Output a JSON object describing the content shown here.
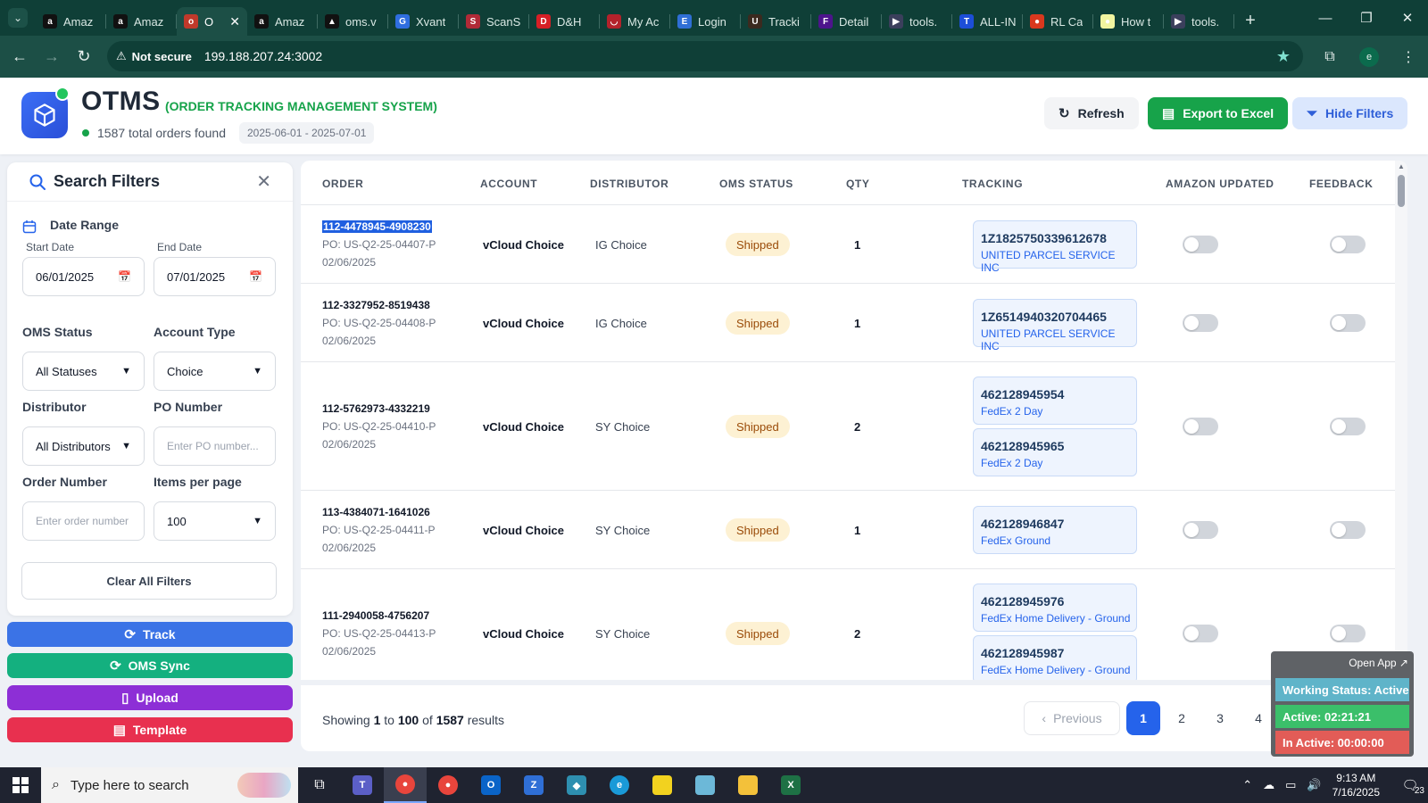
{
  "browser": {
    "tabs": [
      {
        "title": "Amaz",
        "fav_color": "#111111",
        "fav_glyph": "a"
      },
      {
        "title": "Amaz",
        "fav_color": "#111111",
        "fav_glyph": "a"
      },
      {
        "title": "O",
        "fav_color": "#c0392b",
        "fav_glyph": "o",
        "active": true
      },
      {
        "title": "Amaz",
        "fav_color": "#111111",
        "fav_glyph": "a"
      },
      {
        "title": "oms.v",
        "fav_color": "#111111",
        "fav_glyph": "▲"
      },
      {
        "title": "Xvant",
        "fav_color": "#2f6ee0",
        "fav_glyph": "G"
      },
      {
        "title": "ScanS",
        "fav_color": "#b02a37",
        "fav_glyph": "S"
      },
      {
        "title": "D&H",
        "fav_color": "#d61f26",
        "fav_glyph": "D"
      },
      {
        "title": "My Ac",
        "fav_color": "#b3222b",
        "fav_glyph": "◡"
      },
      {
        "title": "Login",
        "fav_color": "#2f6fd6",
        "fav_glyph": "E"
      },
      {
        "title": "Tracki",
        "fav_color": "#3b2a1f",
        "fav_glyph": "U"
      },
      {
        "title": "Detail",
        "fav_color": "#4d148c",
        "fav_glyph": "F"
      },
      {
        "title": "tools.",
        "fav_color": "#3b3f5c",
        "fav_glyph": "▶"
      },
      {
        "title": "ALL-IN",
        "fav_color": "#1d4ed8",
        "fav_glyph": "T"
      },
      {
        "title": "RL Ca",
        "fav_color": "#d9381e",
        "fav_glyph": "●"
      },
      {
        "title": "How t",
        "fav_color": "#f1f5a0",
        "fav_glyph": "●"
      },
      {
        "title": "tools.",
        "fav_color": "#3b3f5c",
        "fav_glyph": "▶"
      }
    ],
    "new_tab": "+",
    "security": "Not secure",
    "url": "199.188.207.24:3002",
    "profile_initial": "e"
  },
  "header": {
    "title": "OTMS",
    "subtitle": "(ORDER TRACKING MANAGEMENT SYSTEM)",
    "orders_found": "1587 total orders found",
    "date_range": "2025-06-01 - 2025-07-01",
    "refresh_label": "Refresh",
    "export_label": "Export to Excel",
    "hide_filters_label": "Hide Filters",
    "accent_color": "#17a34a",
    "brand_color": "#2f5fd8"
  },
  "filters": {
    "title": "Search Filters",
    "close": "✕",
    "date_range_label": "Date Range",
    "start_date_label": "Start Date",
    "start_date": "06/01/2025",
    "end_date_label": "End Date",
    "end_date": "07/01/2025",
    "oms_status_label": "OMS Status",
    "oms_status_value": "All Statuses",
    "account_type_label": "Account Type",
    "account_type_value": "Choice",
    "distributor_label": "Distributor",
    "distributor_value": "All Distributors",
    "po_number_label": "PO Number",
    "po_number_placeholder": "Enter PO number...",
    "order_number_label": "Order Number",
    "order_number_placeholder": "Enter order number",
    "items_per_page_label": "Items per page",
    "items_per_page_value": "100",
    "clear_label": "Clear All Filters"
  },
  "actions": {
    "track": "Track",
    "oms_sync": "OMS Sync",
    "upload": "Upload",
    "template": "Template"
  },
  "table": {
    "columns": [
      "ORDER",
      "ACCOUNT",
      "DISTRIBUTOR",
      "OMS STATUS",
      "QTY",
      "TRACKING",
      "AMAZON UPDATED",
      "FEEDBACK"
    ],
    "rows": [
      {
        "order": "112-4478945-4908230",
        "po": "PO: US-Q2-25-04407-P",
        "date": "02/06/2025",
        "account": "vCloud Choice",
        "distributor": "IG Choice",
        "status": "Shipped",
        "qty": "1",
        "tracking": [
          {
            "number": "1Z1825750339612678",
            "carrier": "UNITED PARCEL SERVICE INC"
          }
        ],
        "selected": true
      },
      {
        "order": "112-3327952-8519438",
        "po": "PO: US-Q2-25-04408-P",
        "date": "02/06/2025",
        "account": "vCloud Choice",
        "distributor": "IG Choice",
        "status": "Shipped",
        "qty": "1",
        "tracking": [
          {
            "number": "1Z6514940320704465",
            "carrier": "UNITED PARCEL SERVICE INC"
          }
        ]
      },
      {
        "order": "112-5762973-4332219",
        "po": "PO: US-Q2-25-04410-P",
        "date": "02/06/2025",
        "account": "vCloud Choice",
        "distributor": "SY Choice",
        "status": "Shipped",
        "qty": "2",
        "tracking": [
          {
            "number": "462128945954",
            "carrier": "FedEx 2 Day"
          },
          {
            "number": "462128945965",
            "carrier": "FedEx 2 Day"
          }
        ]
      },
      {
        "order": "113-4384071-1641026",
        "po": "PO: US-Q2-25-04411-P",
        "date": "02/06/2025",
        "account": "vCloud Choice",
        "distributor": "SY Choice",
        "status": "Shipped",
        "qty": "1",
        "tracking": [
          {
            "number": "462128946847",
            "carrier": "FedEx Ground"
          }
        ]
      },
      {
        "order": "111-2940058-4756207",
        "po": "PO: US-Q2-25-04413-P",
        "date": "02/06/2025",
        "account": "vCloud Choice",
        "distributor": "SY Choice",
        "status": "Shipped",
        "qty": "2",
        "tracking": [
          {
            "number": "462128945976",
            "carrier": "FedEx Home Delivery - Ground"
          },
          {
            "number": "462128945987",
            "carrier": "FedEx Home Delivery - Ground"
          }
        ]
      }
    ]
  },
  "pagination": {
    "showing_prefix": "Showing",
    "from": "1",
    "to_word": "to",
    "to": "100",
    "of_word": "of",
    "total": "1587",
    "results_word": "results",
    "previous": "Previous",
    "pages": [
      "1",
      "2",
      "3",
      "4"
    ],
    "current_page": "1"
  },
  "widget": {
    "open_app": "Open App ↗",
    "working_status": "Working Status: Active",
    "active": "Active: 02:21:21",
    "inactive": "In Active: 00:00:00"
  },
  "taskbar": {
    "search_placeholder": "Type here to search",
    "time": "9:13 AM",
    "date": "7/16/2025",
    "notifications": "23"
  }
}
